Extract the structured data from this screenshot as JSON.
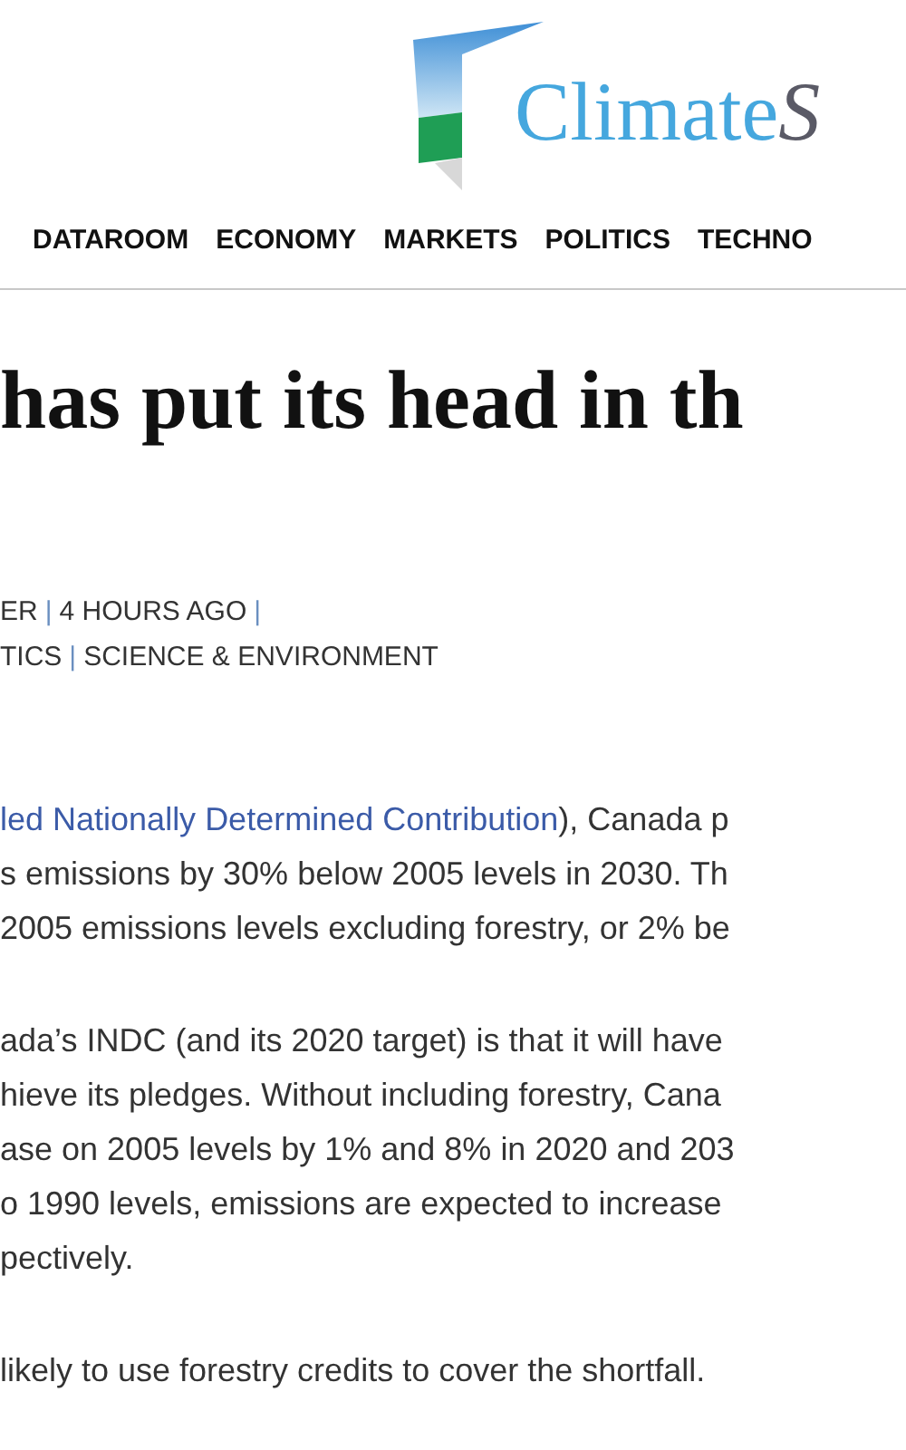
{
  "brand": {
    "name": "Climate",
    "name_cut": "S"
  },
  "nav": [
    {
      "label": "DATAROOM"
    },
    {
      "label": "ECONOMY"
    },
    {
      "label": "MARKETS"
    },
    {
      "label": "POLITICS"
    },
    {
      "label": "TECHNO"
    }
  ],
  "headline": "has put its head in th",
  "meta": [
    [
      {
        "kind": "text",
        "text": "ER"
      },
      {
        "kind": "sep",
        "text": "|"
      },
      {
        "kind": "text",
        "text": "4 HOURS AGO"
      },
      {
        "kind": "sep",
        "text": "|"
      }
    ],
    [
      {
        "kind": "tag",
        "text": "TICS"
      },
      {
        "kind": "sep",
        "text": "|"
      },
      {
        "kind": "tag",
        "text": "SCIENCE & ENVIRONMENT"
      }
    ]
  ],
  "paragraphs": [
    [
      [
        {
          "kind": "link",
          "text": "led Nationally Determined Contribution"
        },
        {
          "kind": "text",
          "text": "), Canada p"
        }
      ],
      [
        {
          "kind": "text",
          "text": "s emissions by 30% below 2005 levels in 2030. Th"
        }
      ],
      [
        {
          "kind": "text",
          "text": "2005 emissions levels excluding forestry, or 2% be"
        }
      ]
    ],
    [
      [
        {
          "kind": "text",
          "text": "ada’s INDC (and its 2020 target) is that it will have"
        }
      ],
      [
        {
          "kind": "text",
          "text": "hieve its pledges. Without including forestry, Cana"
        }
      ],
      [
        {
          "kind": "text",
          "text": "ase on 2005 levels by 1% and 8% in 2020 and 203"
        }
      ],
      [
        {
          "kind": "text",
          "text": "o 1990 levels, emissions are expected to increase"
        }
      ],
      [
        {
          "kind": "text",
          "text": "pectively."
        }
      ]
    ],
    [
      [
        {
          "kind": "text",
          "text": "likely to use forestry credits to cover the shortfall."
        }
      ]
    ]
  ]
}
